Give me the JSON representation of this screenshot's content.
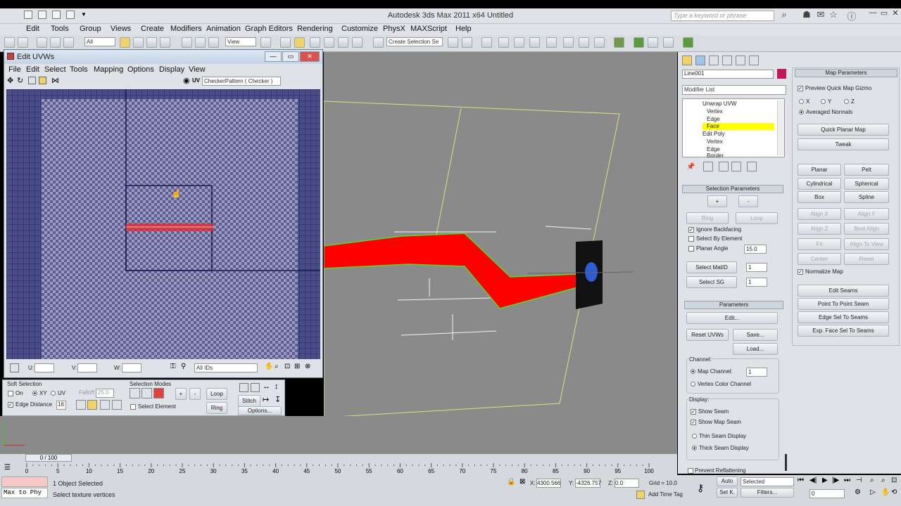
{
  "app": {
    "title": "Autodesk 3ds Max  2011 x64     Untitled",
    "logo": "S",
    "search_placeholder": "Type a keyword or phrase"
  },
  "menu": [
    "Edit",
    "Tools",
    "Group",
    "Views",
    "Create",
    "Modifiers",
    "Animation",
    "Graph Editors",
    "Rendering",
    "Customize",
    "PhysX",
    "MAXScript",
    "Help"
  ],
  "toolbar": {
    "filter": "All",
    "refcoord": "View",
    "selection_set": "Create Selection Se"
  },
  "uvw": {
    "title": "Edit UVWs",
    "menu": [
      "File",
      "Edit",
      "Select",
      "Tools",
      "Mapping",
      "Options",
      "Display",
      "View"
    ],
    "uv_label": "UV",
    "texture": "CheckerPattern  ( Checker )",
    "u_label": "U:",
    "v_label": "V:",
    "w_label": "W:",
    "ids": "All IDs"
  },
  "softsel": {
    "title": "Soft Selection",
    "on": "On",
    "xy": "XY",
    "uv": "UV",
    "falloff_label": "Falloff:",
    "falloff": "25.0",
    "edge_distance": "Edge Distance",
    "edge_value": "16",
    "modes_title": "Selection Modes",
    "select_element": "Select Element",
    "loop": "Loop",
    "ring": "Ring",
    "stitch": "Stitch",
    "options": "Options..."
  },
  "cmd": {
    "object_name": "Line001",
    "modifier_list": "Modifier List",
    "stack": [
      "Unwrap UVW",
      "Vertex",
      "Edge",
      "Face",
      "Edit Poly",
      "Vertex",
      "Edge",
      "Border"
    ],
    "selection_params": "Selection Parameters",
    "plus": "+",
    "minus": "-",
    "ring": "Ring",
    "loop": "Loop",
    "ignore_backfacing": "Ignore Backfacing",
    "select_by_element": "Select By Element",
    "planar_angle": "Planar Angle",
    "planar_value": "15.0",
    "select_matid": "Select MatID",
    "select_sg": "Select SG",
    "matid_value": "1",
    "sg_value": "1",
    "parameters": "Parameters",
    "edit": "Edit...",
    "reset_uvws": "Reset UVWs",
    "save": "Save...",
    "load": "Load...",
    "channel": "Channel:",
    "map_channel": "Map Channel:",
    "map_channel_value": "1",
    "vertex_color_channel": "Vertex Color Channel",
    "display": "Display:",
    "show_seam": "Show Seam",
    "show_map_seam": "Show Map Seam",
    "thin_seam": "Thin Seam Display",
    "thick_seam": "Thick Seam Display",
    "prevent": "Prevent Reflattening"
  },
  "map": {
    "title": "Map Parameters",
    "preview": "Preview Quick Map Gizmo",
    "x": "X",
    "y": "Y",
    "z": "Z",
    "averaged": "Averaged Normals",
    "quick_planar": "Quick Planar Map",
    "tweak": "Tweak",
    "planar": "Planar",
    "pelt": "Pelt",
    "cylindrical": "Cylindrical",
    "spherical": "Spherical",
    "box": "Box",
    "spline": "Spline",
    "align_x": "Align X",
    "align_y": "Align Y",
    "align_z": "Align Z",
    "best_align": "Best Align",
    "fit": "Fit",
    "align_to_view": "Align To View",
    "center": "Center",
    "reset": "Reset",
    "normalize": "Normalize Map",
    "edit_seams": "Edit Seams",
    "point_to_point": "Point To Point Seam",
    "edge_sel": "Edge Sel To Seams",
    "exp_face": "Exp. Face Sel To Seams"
  },
  "timeline": {
    "frame": "0 / 100",
    "ticks": [
      "0",
      "5",
      "10",
      "15",
      "20",
      "25",
      "30",
      "35",
      "40",
      "45",
      "50",
      "55",
      "60",
      "65",
      "70",
      "75",
      "80",
      "85",
      "90",
      "95",
      "100"
    ]
  },
  "status": {
    "maxscript": "Max to Phy",
    "objects": "1 Object Selected",
    "prompt": "Select texture vertices",
    "x_label": "X:",
    "x": "4300.566",
    "y_label": "Y:",
    "y": "-4326.757",
    "z_label": "Z:",
    "z": "0.0",
    "grid": "Grid = 10.0",
    "add_time_tag": "Add Time Tag",
    "auto": "Auto",
    "set_k": "Set K.",
    "selected": "Selected",
    "filters": "Filters...",
    "frame": "0"
  }
}
